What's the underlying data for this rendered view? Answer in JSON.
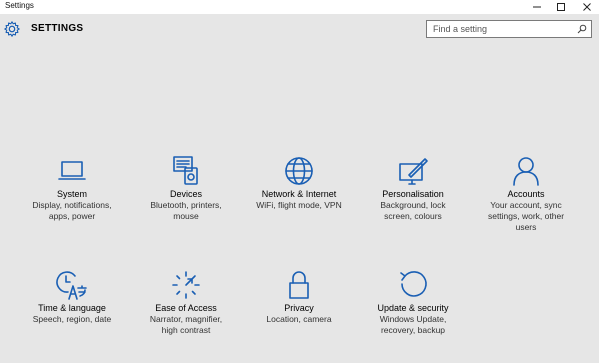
{
  "window": {
    "title": "Settings"
  },
  "header": {
    "title": "SETTINGS"
  },
  "search": {
    "placeholder": "Find a setting"
  },
  "tiles": [
    {
      "name": "System",
      "desc_lines": [
        "Display, notifications,",
        "apps, power"
      ],
      "icon": "laptop-icon"
    },
    {
      "name": "Devices",
      "desc_lines": [
        "Bluetooth, printers,",
        "mouse"
      ],
      "icon": "devices-icon"
    },
    {
      "name": "Network & Internet",
      "desc_lines": [
        "WiFi, flight mode, VPN"
      ],
      "icon": "globe-icon"
    },
    {
      "name": "Personalisation",
      "desc_lines": [
        "Background, lock",
        "screen, colours"
      ],
      "icon": "personalisation-icon"
    },
    {
      "name": "Accounts",
      "desc_lines": [
        "Your account, sync",
        "settings, work, other",
        "users"
      ],
      "icon": "person-icon"
    },
    {
      "name": "Time & language",
      "desc_lines": [
        "Speech, region, date"
      ],
      "icon": "time-language-icon"
    },
    {
      "name": "Ease of Access",
      "desc_lines": [
        "Narrator, magnifier,",
        "high contrast"
      ],
      "icon": "ease-of-access-icon"
    },
    {
      "name": "Privacy",
      "desc_lines": [
        "Location, camera"
      ],
      "icon": "lock-icon"
    },
    {
      "name": "Update & security",
      "desc_lines": [
        "Windows Update,",
        "recovery, backup"
      ],
      "icon": "update-icon"
    }
  ],
  "colors": {
    "accent": "#1a5fb4",
    "background": "#e6e6e6"
  }
}
